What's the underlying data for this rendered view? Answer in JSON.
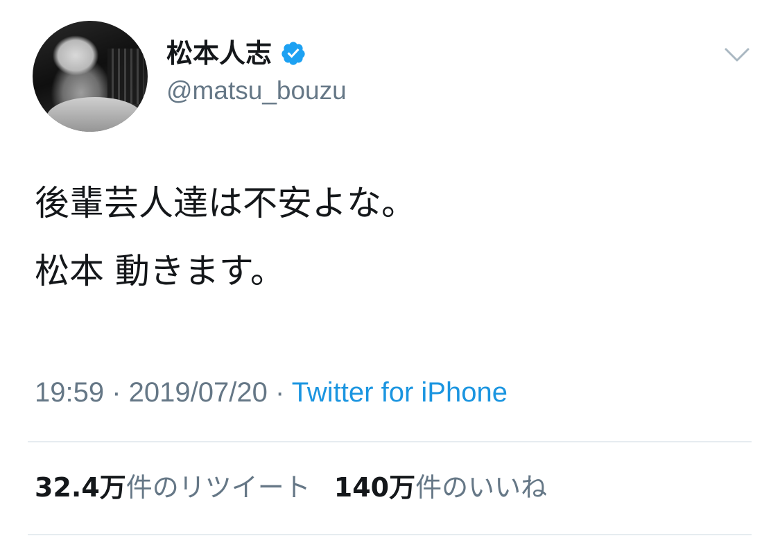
{
  "user": {
    "display_name": "松本人志",
    "handle": "@matsu_bouzu",
    "verified": true
  },
  "tweet": {
    "lines": [
      "後輩芸人達は不安よな。",
      "松本 動きます。"
    ]
  },
  "meta": {
    "time": "19:59",
    "separator1": " · ",
    "date": "2019/07/20",
    "separator2": " · ",
    "source": "Twitter for iPhone"
  },
  "stats": {
    "retweets_count": "32.4万",
    "retweets_label": "件のリツイート",
    "likes_count": "140万",
    "likes_label": "件のいいね"
  },
  "icons": {
    "verified": "verified-badge-icon",
    "menu": "chevron-down-icon"
  },
  "colors": {
    "text": "#14171a",
    "secondary": "#657786",
    "link": "#1b95e0",
    "verified": "#1da1f2",
    "divider": "#e6ecf0"
  }
}
